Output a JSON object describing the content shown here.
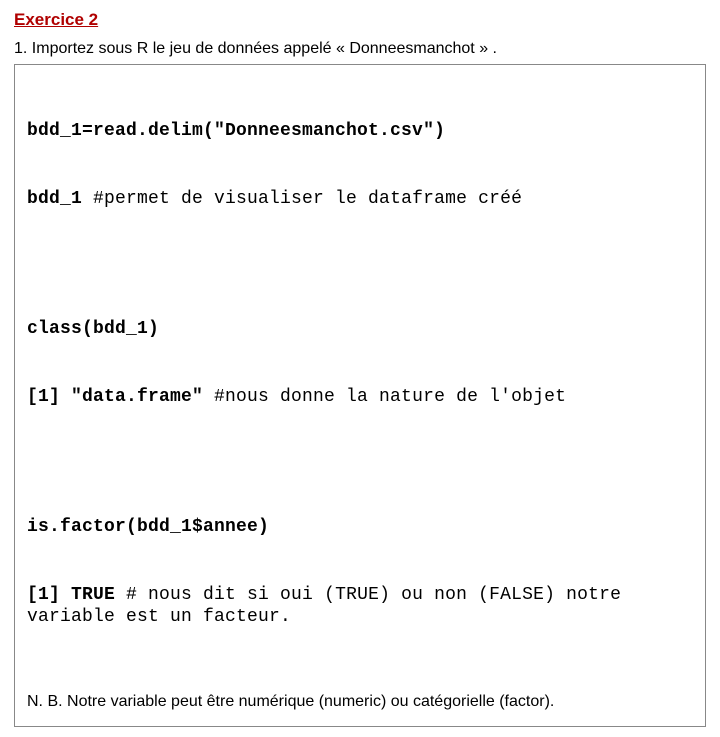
{
  "title": "Exercice 2",
  "intro": "1. Importez sous R le jeu de données appelé « Donneesmanchot » .",
  "block1": {
    "l1a": "bdd_1=read.delim(\"Donneesmanchot.csv\")",
    "l2a": "bdd_1 ",
    "l2b": "#permet de visualiser le dataframe créé"
  },
  "block2": {
    "l1a": "class(bdd_1)",
    "l2a": "[1] \"data.frame\" ",
    "l2b": "#nous donne la nature de l'objet"
  },
  "block3": {
    "l1a": "is.factor(bdd_1$annee)",
    "l2a": "[1] TRUE ",
    "l2b": "# nous dit si oui (TRUE) ou non (FALSE) notre variable est un facteur."
  },
  "nb": "N. B. Notre variable peut être numérique (numeric) ou catégorielle (factor)."
}
